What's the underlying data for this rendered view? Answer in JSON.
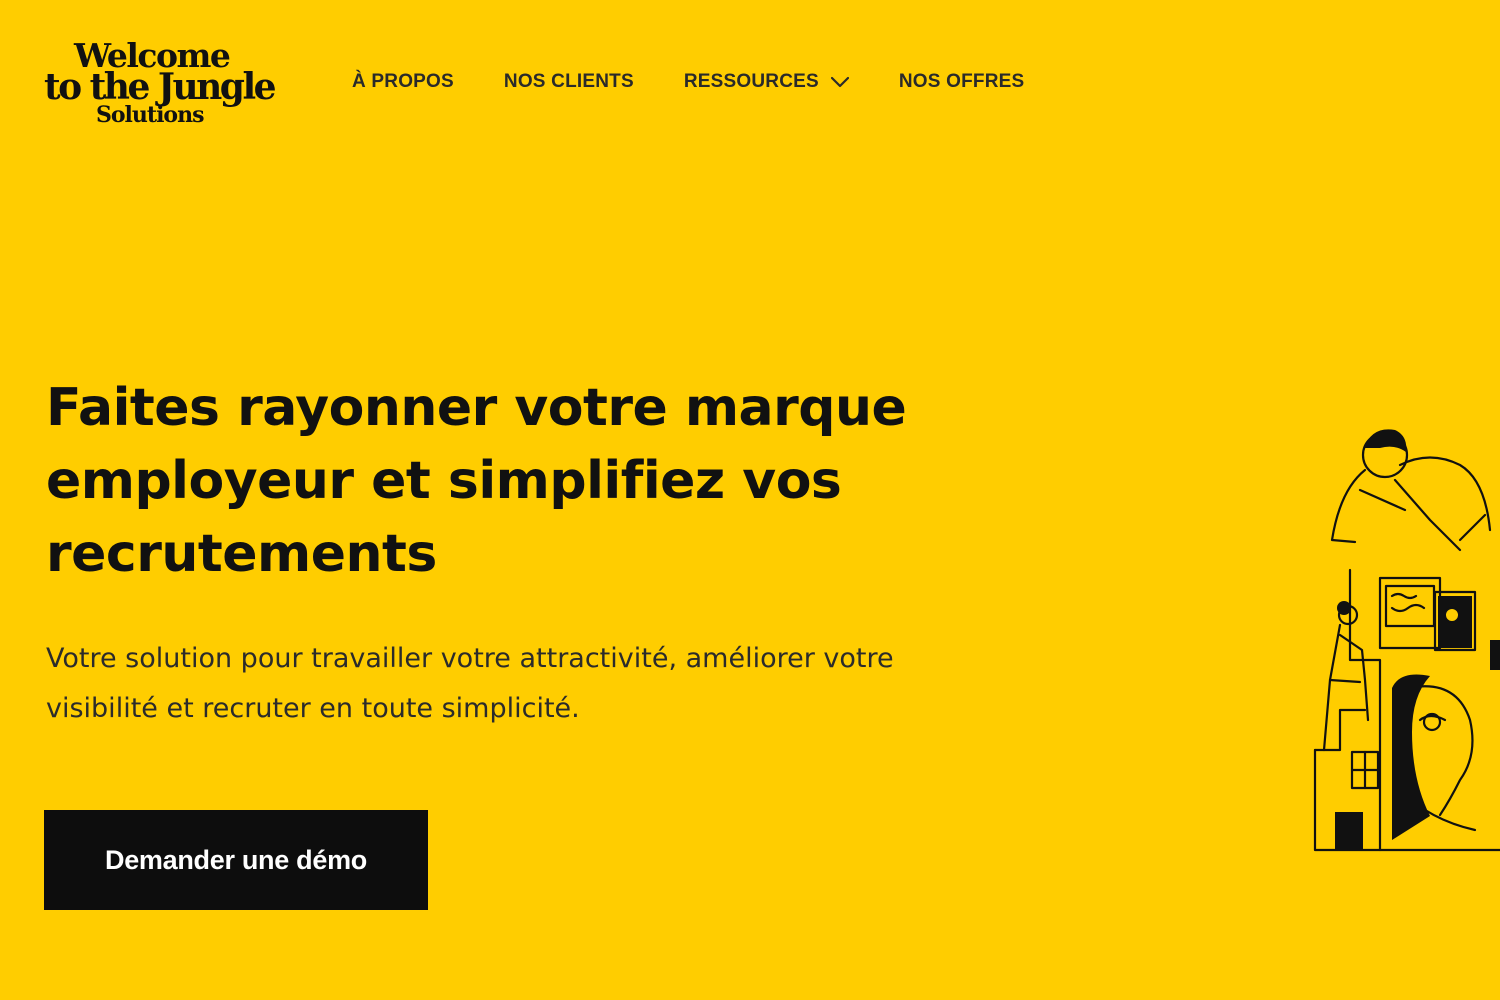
{
  "logo": {
    "line1": "Welcome",
    "line2": "to the Jungle",
    "line3": "Solutions"
  },
  "nav": {
    "items": [
      {
        "label": "À PROPOS"
      },
      {
        "label": "NOS CLIENTS"
      },
      {
        "label": "RESSOURCES",
        "icon": "chevron-down-icon"
      },
      {
        "label": "NOS OFFRES"
      }
    ]
  },
  "hero": {
    "headline": "Faites rayonner votre marque employeur et simplifiez vos recrutements",
    "subtitle": "Votre solution pour travailler votre attractivité, améliorer votre visibilité et recruter en toute simplicité.",
    "cta_label": "Demander une démo"
  },
  "colors": {
    "background": "#FFCD00",
    "text": "#111111",
    "button_bg": "#0D0D0D",
    "button_text": "#FFFFFF"
  },
  "illustration": {
    "icon": "people-building-illustration"
  }
}
